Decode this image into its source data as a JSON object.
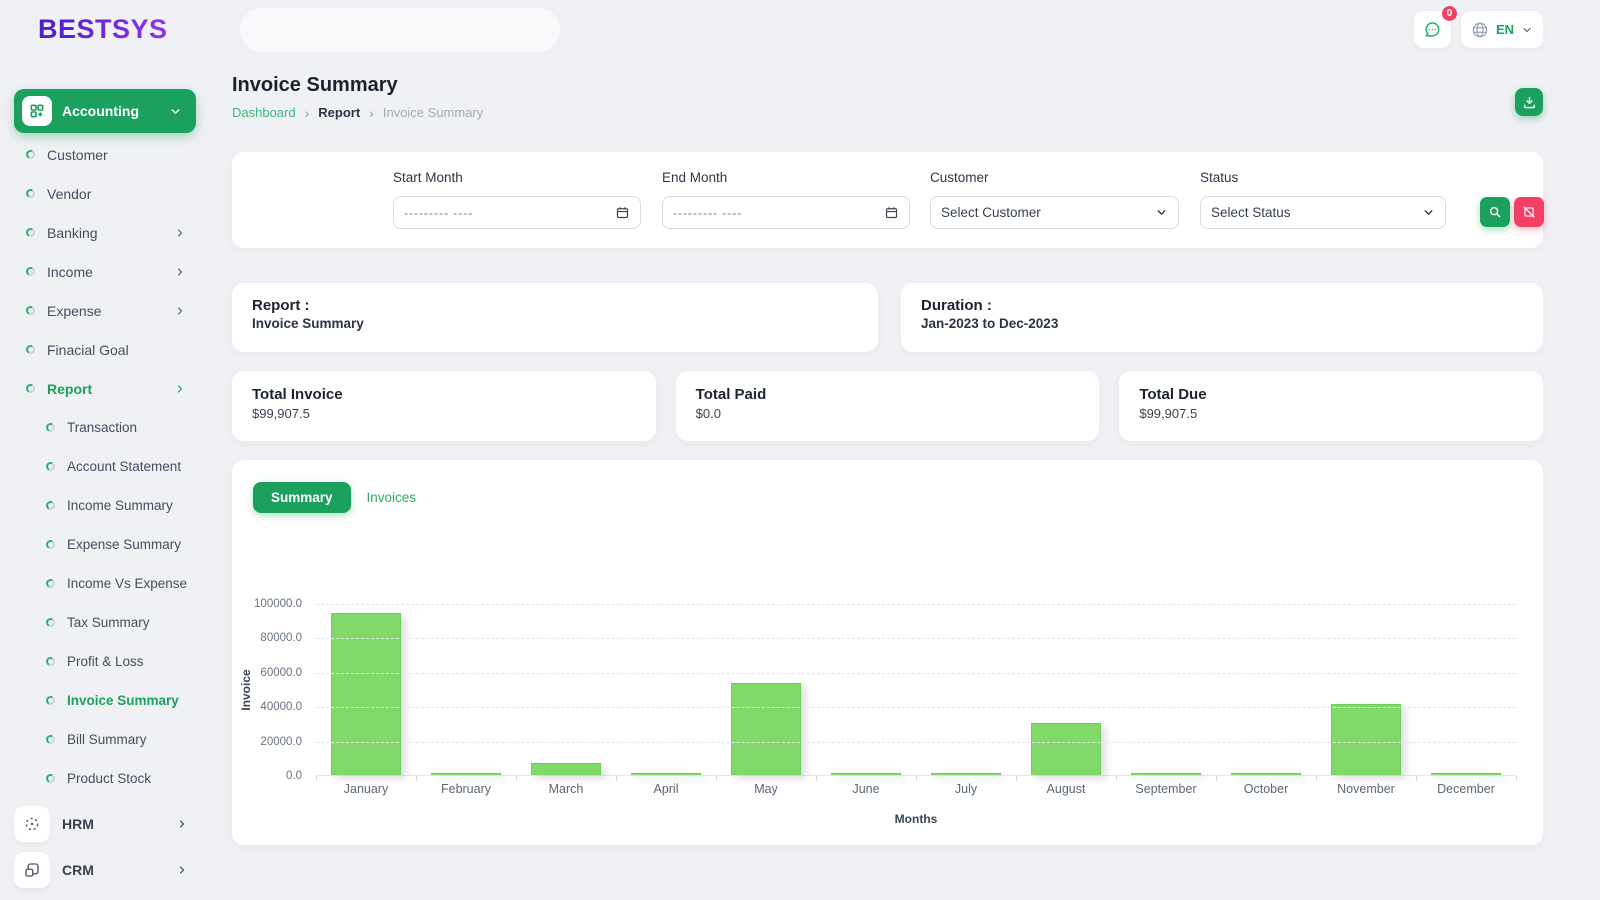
{
  "brand": {
    "logo": "BESTSYS"
  },
  "header": {
    "notification_badge": "0",
    "language": "EN"
  },
  "sidebar": {
    "active_module": {
      "label": "Accounting"
    },
    "items": [
      {
        "label": "Customer",
        "chevron": false,
        "active": false
      },
      {
        "label": "Vendor",
        "chevron": false,
        "active": false
      },
      {
        "label": "Banking",
        "chevron": true,
        "active": false
      },
      {
        "label": "Income",
        "chevron": true,
        "active": false
      },
      {
        "label": "Expense",
        "chevron": true,
        "active": false
      },
      {
        "label": "Finacial Goal",
        "chevron": false,
        "active": false
      },
      {
        "label": "Report",
        "chevron": true,
        "active": true
      }
    ],
    "report_subitems": [
      {
        "label": "Transaction",
        "active": false
      },
      {
        "label": "Account Statement",
        "active": false
      },
      {
        "label": "Income Summary",
        "active": false
      },
      {
        "label": "Expense Summary",
        "active": false
      },
      {
        "label": "Income Vs Expense",
        "active": false
      },
      {
        "label": "Tax Summary",
        "active": false
      },
      {
        "label": "Profit & Loss",
        "active": false
      },
      {
        "label": "Invoice Summary",
        "active": true
      },
      {
        "label": "Bill Summary",
        "active": false
      },
      {
        "label": "Product Stock",
        "active": false
      }
    ],
    "modules": [
      {
        "label": "HRM",
        "icon": "hrm-icon"
      },
      {
        "label": "CRM",
        "icon": "crm-icon"
      }
    ]
  },
  "page": {
    "title": "Invoice Summary",
    "breadcrumb": [
      "Dashboard",
      "Report",
      "Invoice Summary"
    ]
  },
  "filters": {
    "start_month_label": "Start Month",
    "end_month_label": "End Month",
    "date_placeholder": "--------- ----",
    "customer_label": "Customer",
    "customer_value": "Select Customer",
    "status_label": "Status",
    "status_value": "Select Status"
  },
  "report_info": {
    "title": "Report :",
    "value": "Invoice Summary"
  },
  "duration_info": {
    "title": "Duration :",
    "value": "Jan-2023 to Dec-2023"
  },
  "stats": [
    {
      "label": "Total Invoice",
      "value": "$99,907.5"
    },
    {
      "label": "Total Paid",
      "value": "$0.0"
    },
    {
      "label": "Total Due",
      "value": "$99,907.5"
    }
  ],
  "tabs": [
    {
      "label": "Summary",
      "active": true
    },
    {
      "label": "Invoices",
      "active": false
    }
  ],
  "chart_data": {
    "type": "bar",
    "title": "",
    "categories": [
      "January",
      "February",
      "March",
      "April",
      "May",
      "June",
      "July",
      "August",
      "September",
      "October",
      "November",
      "December"
    ],
    "values": [
      94000,
      1000,
      6800,
      1000,
      53500,
      1000,
      1000,
      30000,
      1000,
      1000,
      41000,
      1000
    ],
    "xlabel": "Months",
    "ylabel": "Invoice",
    "ylim": [
      0,
      100000
    ],
    "yticks": [
      "100000.0",
      "80000.0",
      "60000.0",
      "40000.0",
      "20000.0",
      "0.0"
    ],
    "legend": "none",
    "grid": "horizontal-dashed",
    "bar_color": "#81d96a",
    "bar_stroke": "#6fcf59"
  },
  "colors": {
    "accent_green": "#1ba15d",
    "link_green": "#3db67e",
    "pink": "#f23f63",
    "logo_purple": "#6d28d9",
    "background": "#f0f1f5"
  }
}
